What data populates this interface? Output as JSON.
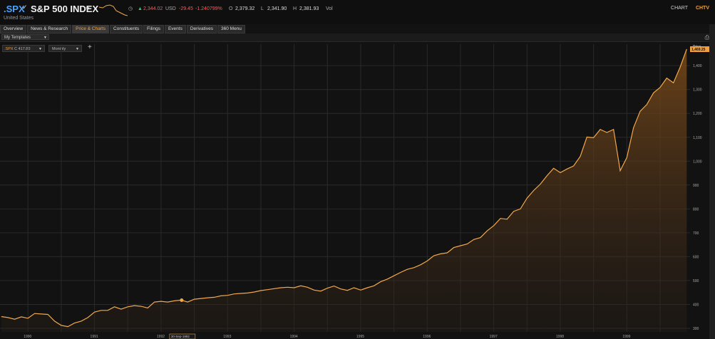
{
  "header": {
    "ric": ".SPX",
    "title": "S&P 500 INDEX",
    "country": "United States",
    "last": "2,344.02",
    "currency": "USD",
    "change": "-29.45",
    "pct_change": "-1.240799%",
    "open_label": "O",
    "open": "2,379.32",
    "low_label": "L",
    "low": "2,341.90",
    "high_label": "H",
    "high": "2,381.93",
    "vol_label": "Vol",
    "chart_label": "CHART",
    "chart_code": "CHTV"
  },
  "tabs": [
    {
      "label": "Overview",
      "active": false
    },
    {
      "label": "News & Research",
      "active": false
    },
    {
      "label": "Price & Charts",
      "active": true
    },
    {
      "label": "Constituents",
      "active": false
    },
    {
      "label": "Filings",
      "active": false
    },
    {
      "label": "Events",
      "active": false
    },
    {
      "label": "Derivatives",
      "active": false
    },
    {
      "label": "360 Menu",
      "active": false
    }
  ],
  "templates": {
    "label": "My Templates"
  },
  "toolbar": {
    "symbol": ".SPX",
    "close_label": "C 417.80",
    "interval": "Monthly"
  },
  "colors": {
    "accent": "#f0a040",
    "line": "#f2a84a",
    "negative": "#ff5a5a",
    "positive_arrow": "#37c46a",
    "link": "#4aa3ff",
    "background": "#121212"
  },
  "icons": [
    "pin-icon",
    "dropdown-icon",
    "clock-icon",
    "up-arrow-icon",
    "printer-icon",
    "plus-icon"
  ],
  "chart_data": {
    "type": "area",
    "ylabel": "Price",
    "yunit": "USD",
    "ylim": [
      285,
      1490
    ],
    "yticks": [
      300,
      400,
      500,
      600,
      700,
      800,
      900,
      1000,
      1100,
      1200,
      1300,
      1400
    ],
    "ytick_labels": [
      "300",
      "400",
      "500",
      "600",
      "700",
      "800",
      "900",
      "1,000",
      "1,100",
      "1,200",
      "1,300",
      "1,400"
    ],
    "xticks": [
      1990,
      1991,
      1992,
      1993,
      1994,
      1995,
      1996,
      1997,
      1998,
      1999
    ],
    "xtick_labels": [
      "1990",
      "1991",
      "1992",
      "1993",
      "1994",
      "1995",
      "1996",
      "1997",
      "1998",
      "1999"
    ],
    "xlim": [
      1989.58,
      1999.95
    ],
    "grid": true,
    "last_value_label": "1,469.25",
    "crosshair": {
      "x": 1992.31,
      "value": 417.8,
      "date_label": "30-Sep-1992"
    },
    "x": [
      1989.6,
      1989.7,
      1989.8,
      1989.9,
      1990.0,
      1990.1,
      1990.2,
      1990.3,
      1990.4,
      1990.5,
      1990.6,
      1990.7,
      1990.8,
      1990.9,
      1991.0,
      1991.1,
      1991.2,
      1991.3,
      1991.4,
      1991.5,
      1991.6,
      1991.7,
      1991.8,
      1991.9,
      1992.0,
      1992.1,
      1992.2,
      1992.3,
      1992.4,
      1992.5,
      1992.6,
      1992.7,
      1992.8,
      1992.9,
      1993.0,
      1993.1,
      1993.2,
      1993.3,
      1993.4,
      1993.5,
      1993.6,
      1993.7,
      1993.8,
      1993.9,
      1994.0,
      1994.1,
      1994.2,
      1994.3,
      1994.4,
      1994.5,
      1994.6,
      1994.7,
      1994.8,
      1994.9,
      1995.0,
      1995.1,
      1995.2,
      1995.3,
      1995.4,
      1995.5,
      1995.6,
      1995.7,
      1995.8,
      1995.9,
      1996.0,
      1996.1,
      1996.2,
      1996.3,
      1996.4,
      1996.5,
      1996.6,
      1996.7,
      1996.8,
      1996.9,
      1997.0,
      1997.1,
      1997.2,
      1997.3,
      1997.4,
      1997.5,
      1997.6,
      1997.7,
      1997.8,
      1997.9,
      1998.0,
      1998.1,
      1998.2,
      1998.3,
      1998.4,
      1998.5,
      1998.6,
      1998.7,
      1998.8,
      1998.9,
      1999.0,
      1999.1,
      1999.2,
      1999.3,
      1999.4,
      1999.5,
      1999.6,
      1999.7,
      1999.8,
      1999.9
    ],
    "values": [
      349,
      345,
      338,
      348,
      342,
      362,
      360,
      358,
      330,
      312,
      307,
      322,
      330,
      345,
      368,
      375,
      375,
      390,
      380,
      390,
      395,
      392,
      385,
      410,
      413,
      410,
      415,
      418,
      410,
      422,
      425,
      428,
      430,
      436,
      438,
      444,
      446,
      448,
      452,
      458,
      462,
      466,
      470,
      472,
      470,
      478,
      472,
      460,
      456,
      468,
      477,
      465,
      459,
      470,
      460,
      470,
      478,
      495,
      506,
      520,
      534,
      547,
      554,
      566,
      582,
      604,
      612,
      616,
      638,
      646,
      653,
      672,
      680,
      708,
      730,
      760,
      757,
      790,
      800,
      845,
      877,
      904,
      939,
      970,
      952,
      967,
      980,
      1020,
      1101,
      1098,
      1133,
      1120,
      1133,
      960,
      1015,
      1140,
      1209,
      1237,
      1286,
      1309,
      1348,
      1328,
      1393,
      1469
    ]
  }
}
